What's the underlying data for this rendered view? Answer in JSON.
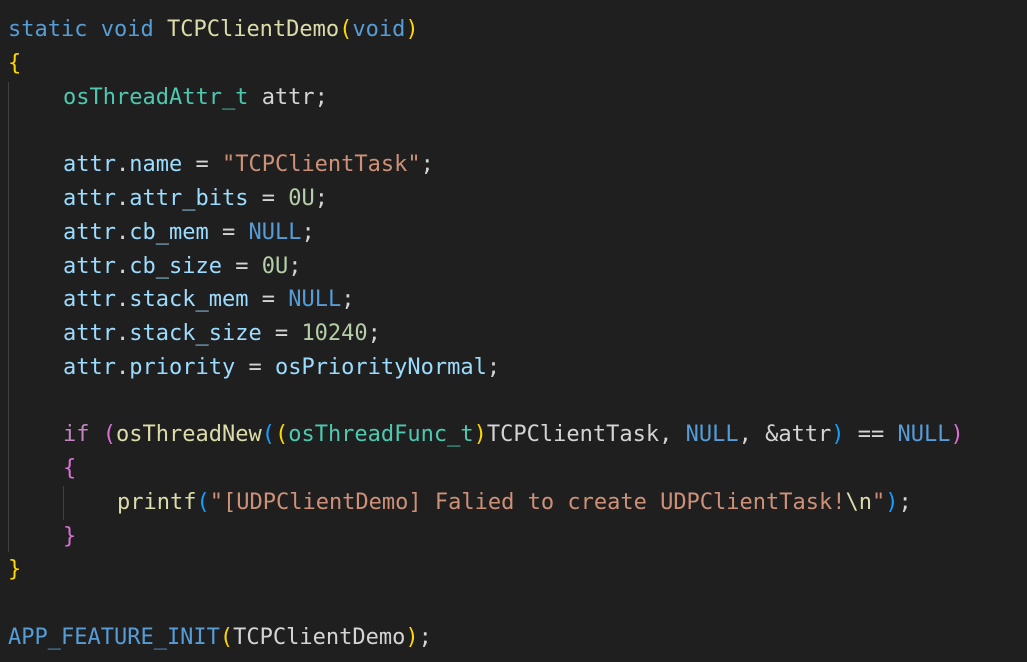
{
  "editor": {
    "tokens": {
      "static": "static",
      "void": "void",
      "func_name": "TCPClientDemo",
      "type_attr": "osThreadAttr_t",
      "attr": "attr",
      "name": "name",
      "attr_bits": "attr_bits",
      "cb_mem": "cb_mem",
      "cb_size": "cb_size",
      "stack_mem": "stack_mem",
      "stack_size": "stack_size",
      "priority": "priority",
      "task_name_str": "\"TCPClientTask\"",
      "zero_u": "0U",
      "null": "NULL",
      "stack_size_val": "10240",
      "priority_val": "osPriorityNormal",
      "if": "if",
      "os_thread_new": "osThreadNew",
      "os_thread_func_t": "osThreadFunc_t",
      "task_fn": "TCPClientTask",
      "printf": "printf",
      "printf_str": "\"[UDPClientDemo] Falied to create UDPClientTask!",
      "newline_escape": "\\n",
      "quote": "\"",
      "app_feature_init": "APP_FEATURE_INIT",
      "open_paren": "(",
      "close_paren": ")",
      "open_brace": "{",
      "close_brace": "}",
      "semicolon": ";",
      "dot": ".",
      "assign": " = ",
      "comma": ", ",
      "amp": "&",
      "eqeq": " == ",
      "space": " "
    },
    "colors": {
      "background": "#1f1f1f",
      "keyword": "#569cd6",
      "function": "#dcdcaa",
      "type": "#4ec9b0",
      "variable": "#9cdcfe",
      "string": "#ce9178",
      "number": "#b5cea8",
      "control": "#c586c0",
      "bracket_level1": "#ffd700",
      "bracket_level2": "#da70d6",
      "bracket_level3": "#179fff"
    }
  }
}
